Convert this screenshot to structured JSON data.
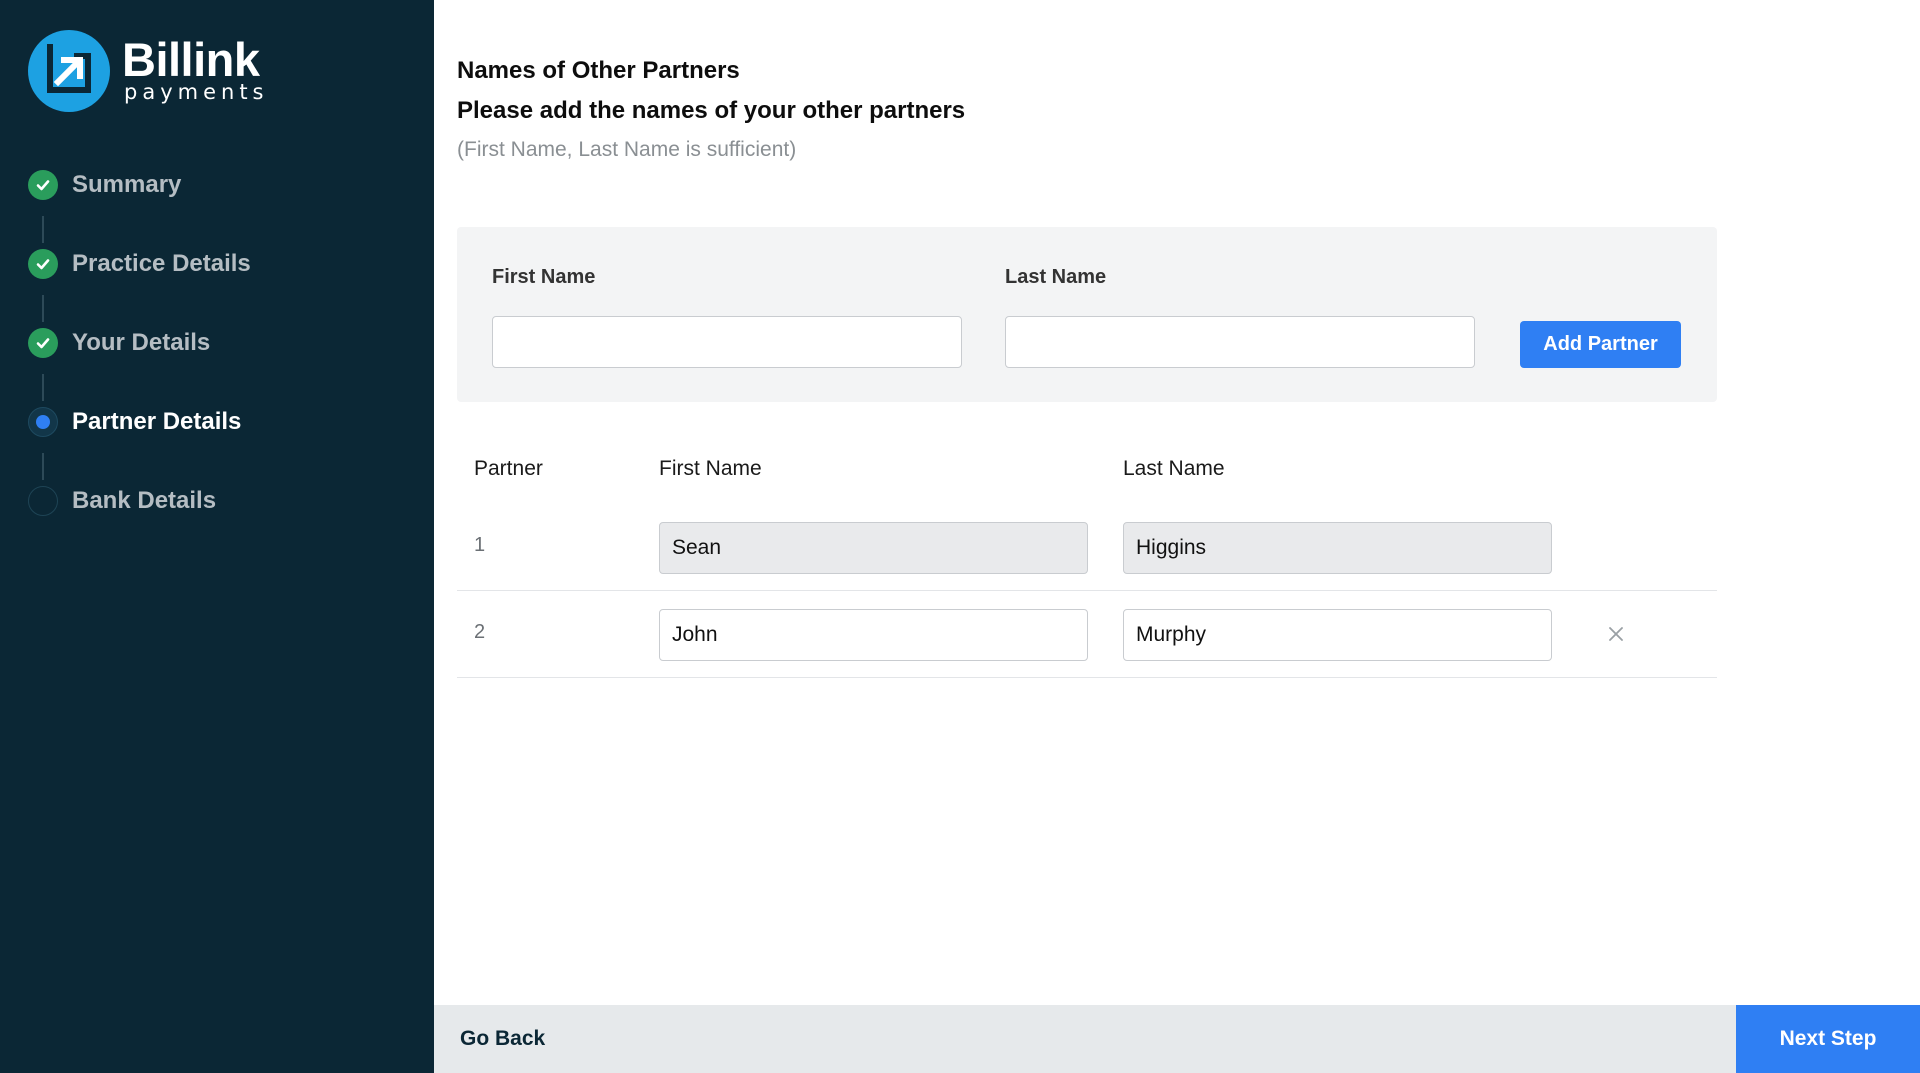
{
  "brand": {
    "name": "Billink",
    "tagline": "payments",
    "color": "#1da1e2"
  },
  "colors": {
    "sidebar_bg": "#0b2735",
    "accent": "#2f7ff3",
    "done": "#2a9d5c"
  },
  "steps": [
    {
      "label": "Summary",
      "state": "done"
    },
    {
      "label": "Practice Details",
      "state": "done"
    },
    {
      "label": "Your Details",
      "state": "done"
    },
    {
      "label": "Partner Details",
      "state": "current"
    },
    {
      "label": "Bank Details",
      "state": "pending"
    }
  ],
  "section": {
    "title": "Names of Other Partners",
    "subtitle": "Please add the names of your other partners",
    "hint": "(First Name, Last Name is sufficient)"
  },
  "add_form": {
    "first_name_label": "First Name",
    "last_name_label": "Last Name",
    "first_name_value": "",
    "last_name_value": "",
    "add_button": "Add Partner"
  },
  "table": {
    "headers": {
      "partner": "Partner",
      "first_name": "First Name",
      "last_name": "Last Name"
    },
    "rows": [
      {
        "num": "1",
        "first": "Sean",
        "last": "Higgins",
        "removable": false
      },
      {
        "num": "2",
        "first": "John",
        "last": "Murphy",
        "removable": true
      }
    ]
  },
  "footer": {
    "back": "Go Back",
    "next": "Next Step"
  }
}
